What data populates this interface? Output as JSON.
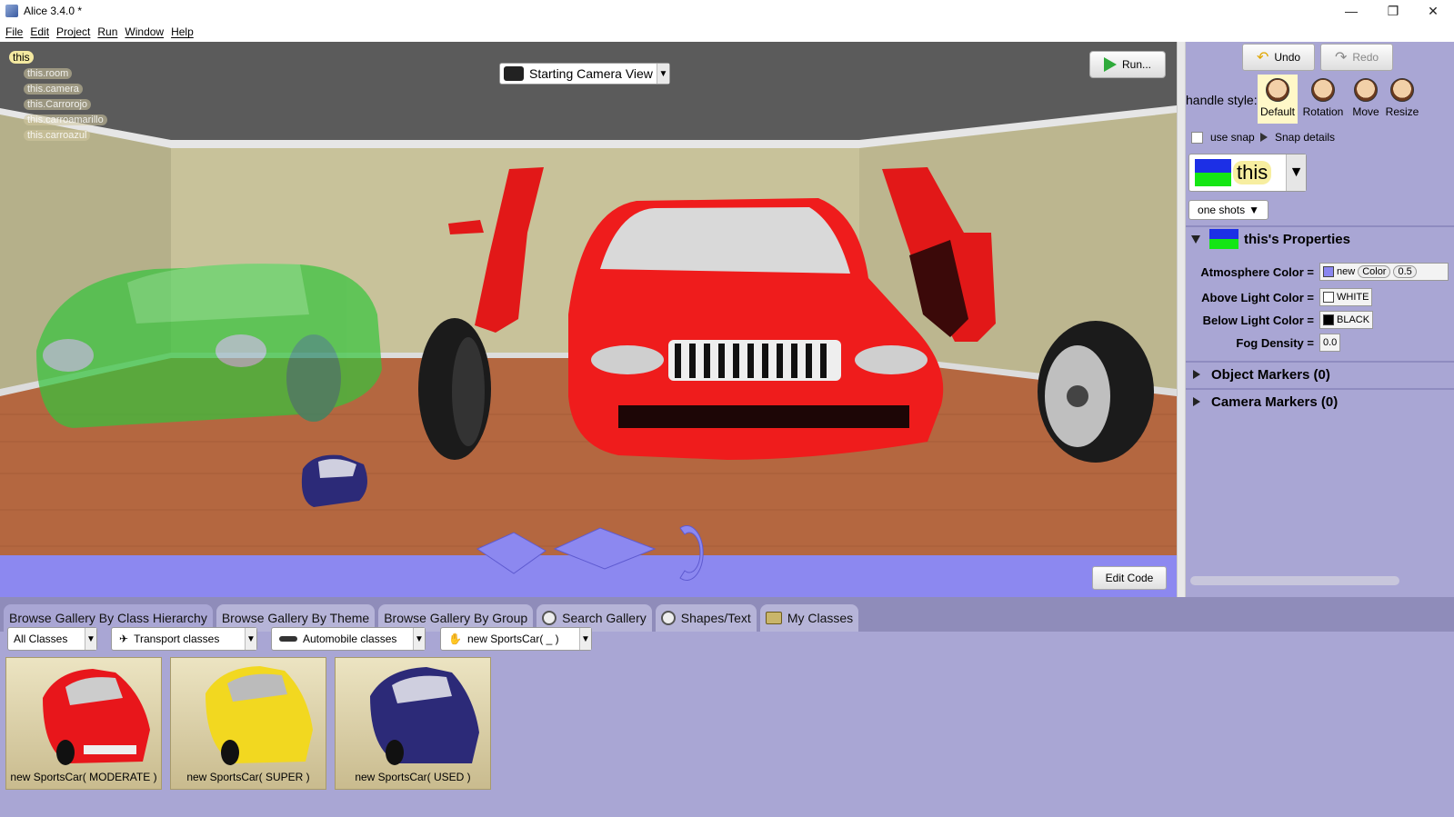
{
  "window": {
    "title": "Alice 3.4.0  *",
    "minimize_glyph": "—",
    "restore_glyph": "❐",
    "close_glyph": "✕"
  },
  "menu": [
    "File",
    "Edit",
    "Project",
    "Run",
    "Window",
    "Help"
  ],
  "scene": {
    "tree_root": "this",
    "tree_children": [
      "this.room",
      "this.camera",
      "this.Carrorojo",
      "this.carroamarillo",
      "this.carroazul"
    ],
    "camera_view": "Starting Camera View",
    "run_label": "Run...",
    "edit_code_label": "Edit Code"
  },
  "toolbar": {
    "undo_label": "Undo",
    "redo_label": "Redo"
  },
  "handle_style": {
    "label": "handle style:",
    "options": [
      "Default",
      "Rotation",
      "Move",
      "Resize"
    ],
    "selected": "Default"
  },
  "snap": {
    "use_snap_label": "use snap",
    "snap_details_label": "Snap details"
  },
  "instance": {
    "name": "this",
    "one_shots_label": "one shots"
  },
  "properties": {
    "header": "this's Properties",
    "rows": [
      {
        "label": "Atmosphere Color =",
        "value_new": "new",
        "value_color": "Color",
        "value_num": "0.5",
        "swatch": "#8a86f0"
      },
      {
        "label": "Above Light Color =",
        "value": "WHITE",
        "swatch": "#ffffff"
      },
      {
        "label": "Below Light Color =",
        "value": "BLACK",
        "swatch": "#000000"
      },
      {
        "label": "Fog Density =",
        "value": "0.0"
      }
    ],
    "object_markers": "Object Markers (0)",
    "camera_markers": "Camera Markers (0)"
  },
  "gallery": {
    "tabs": [
      "Browse Gallery By Class Hierarchy",
      "Browse Gallery By Theme",
      "Browse Gallery By Group",
      "Search Gallery",
      "Shapes/Text",
      "My Classes"
    ],
    "active_tab": "Browse Gallery By Class Hierarchy",
    "breadcrumbs": [
      "All Classes",
      "Transport classes",
      "Automobile classes",
      "new SportsCar( _ )"
    ],
    "items": [
      {
        "caption": "new SportsCar( MODERATE )",
        "color": "#e8161b"
      },
      {
        "caption": "new SportsCar( SUPER )",
        "color": "#f2d820"
      },
      {
        "caption": "new SportsCar( USED )",
        "color": "#2c2a78"
      }
    ]
  },
  "colors": {
    "panel_bg": "#a9a6d4",
    "scene_floor": "#b8683e",
    "scene_wall": "#c9c39b",
    "red_car": "#ef1c1c",
    "green_car": "#2fc23a"
  }
}
